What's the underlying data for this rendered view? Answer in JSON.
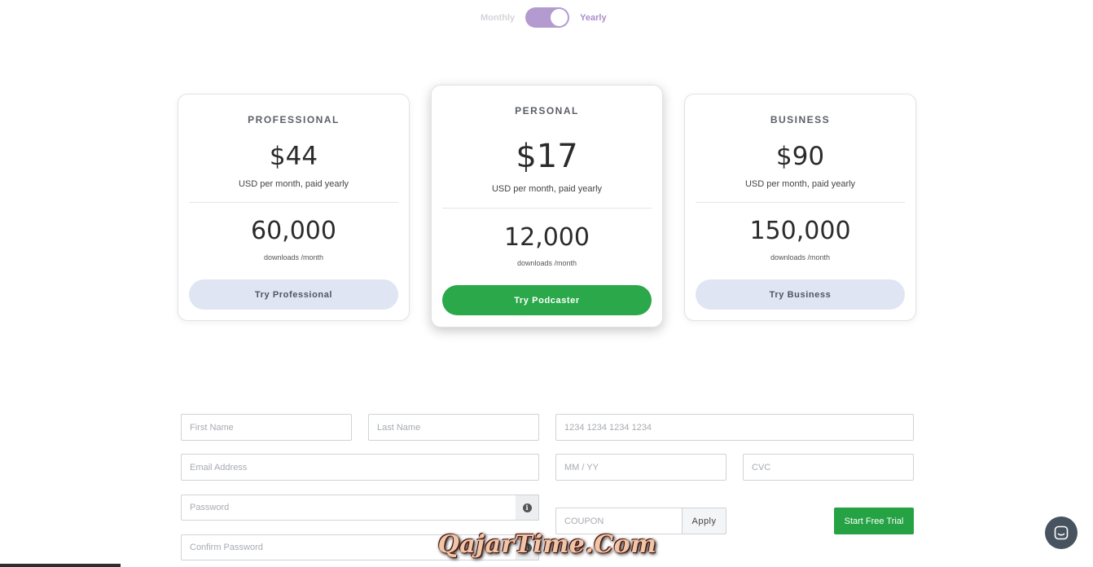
{
  "billing": {
    "monthly_label": "Monthly",
    "yearly_label": "Yearly",
    "selected": "Yearly"
  },
  "plans": [
    {
      "name": "PROFESSIONAL",
      "price": "$44",
      "price_note": "USD per month, paid yearly",
      "downloads": "60,000",
      "downloads_note": "downloads /month",
      "cta": "Try Professional"
    },
    {
      "name": "PERSONAL",
      "price": "$17",
      "price_note": "USD per month, paid yearly",
      "downloads": "12,000",
      "downloads_note": "downloads /month",
      "cta": "Try Podcaster"
    },
    {
      "name": "BUSINESS",
      "price": "$90",
      "price_note": "USD per month, paid yearly",
      "downloads": "150,000",
      "downloads_note": "downloads /month",
      "cta": "Try Business"
    }
  ],
  "form": {
    "first_name_placeholder": "First Name",
    "last_name_placeholder": "Last Name",
    "email_placeholder": "Email Address",
    "password_placeholder": "Password",
    "confirm_password_placeholder": "Confirm Password",
    "card_number_placeholder": "1234 1234 1234 1234",
    "expiry_placeholder": "MM / YY",
    "cvc_placeholder": "CVC",
    "coupon_placeholder": "COUPON",
    "apply_label": "Apply",
    "submit_label": "Start Free Trial"
  },
  "colors": {
    "toggle": "#b39bd0",
    "primary_green": "#2aa84a",
    "secondary_button": "#dfe5f3",
    "chat_launcher": "#47535e"
  },
  "icons": {
    "password_info": "info-icon",
    "chat": "chat-bubble-icon"
  },
  "watermark": "QajarTime.Com"
}
